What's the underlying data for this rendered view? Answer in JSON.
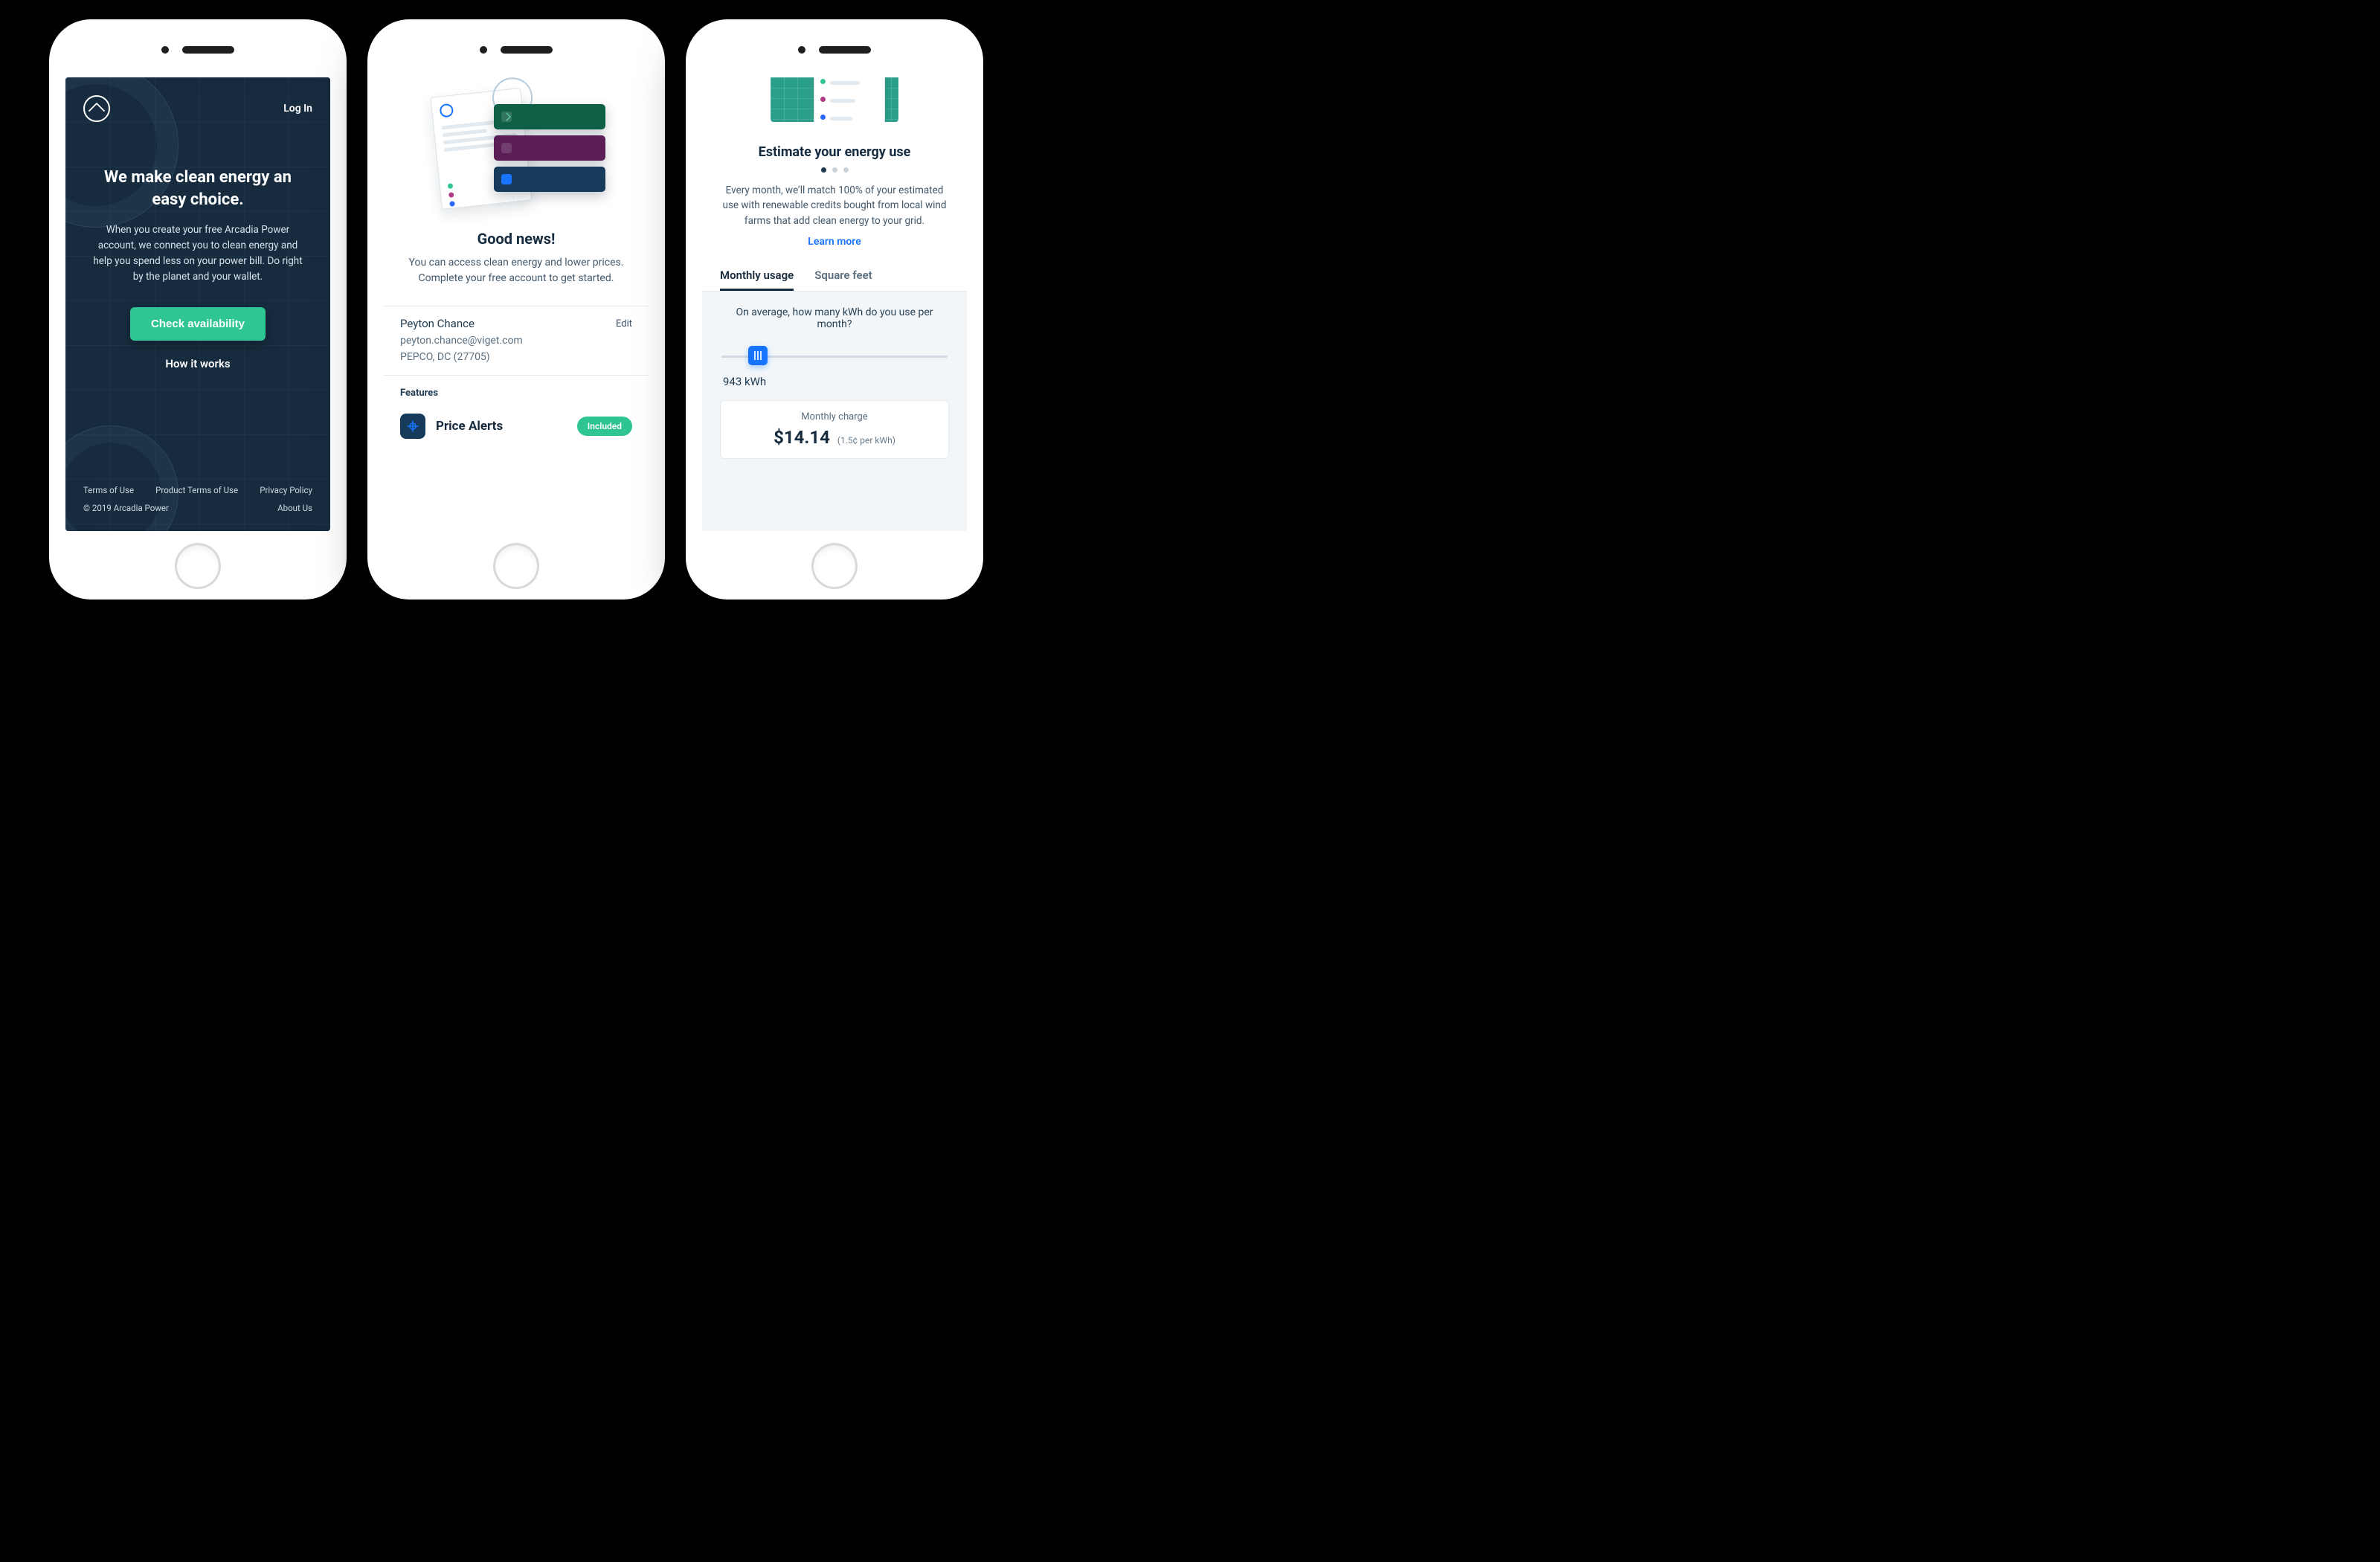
{
  "colors": {
    "navy": "#162b3e",
    "teal": "#30c594",
    "blue": "#1674ff",
    "grayPanel": "#f2f6f9"
  },
  "phone1": {
    "login": "Log In",
    "hero_title": "We make clean energy an easy choice.",
    "hero_body": "When you create your free Arcadia Power account, we connect you to clean energy and help you spend less on your power bill. Do right by the planet and your wallet.",
    "cta": "Check availability",
    "how": "How it works",
    "footer": {
      "terms": "Terms of Use",
      "product_terms": "Product Terms of Use",
      "privacy": "Privacy Policy",
      "copyright": "© 2019 Arcadia Power",
      "about": "About Us"
    }
  },
  "phone2": {
    "title": "Good news!",
    "body": "You can access clean energy and lower prices. Complete your free account to get started.",
    "account": {
      "name": "Peyton Chance",
      "email": "peyton.chance@viget.com",
      "utility": "PEPCO, DC (27705)",
      "edit": "Edit"
    },
    "features_heading": "Features",
    "feature1": {
      "name": "Price Alerts",
      "badge": "Included",
      "icon": "price-alerts-icon"
    }
  },
  "phone3": {
    "title": "Estimate your energy use",
    "body": "Every month, we’ll match 100% of your estimated use with renewable credits bought from local wind farms that add clean energy to your grid.",
    "learn": "Learn more",
    "tabs": {
      "usage": "Monthly usage",
      "sqft": "Square feet",
      "active": "usage"
    },
    "question": "On average, how many kWh do you use per month?",
    "slider": {
      "value": 943,
      "unit": "kWh",
      "percent": 16
    },
    "value_display": "943 kWh",
    "charge": {
      "label": "Monthly charge",
      "amount": "$14.14",
      "rate": "(1.5¢ per kWh)"
    },
    "pager": {
      "count": 3,
      "active": 0
    }
  }
}
